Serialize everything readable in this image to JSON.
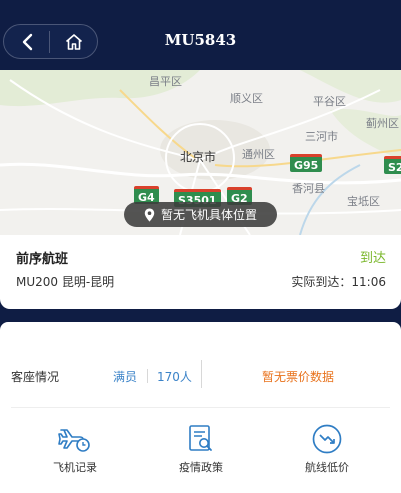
{
  "header": {
    "title": "MU5843"
  },
  "map": {
    "labels": {
      "changping": "昌平区",
      "shunyi": "顺义区",
      "pinggu": "平谷区",
      "jizhou": "蓟州区",
      "sanhe": "三河市",
      "beijing": "北京市",
      "tongzhou": "通州区",
      "xianghe": "香河县",
      "baodi": "宝坻区"
    },
    "shields": {
      "g95": "G95",
      "g4": "G4",
      "s3501": "S3501",
      "g2": "G2",
      "s2": "S2"
    },
    "location_tip": "暂无飞机具体位置"
  },
  "previous_flight": {
    "title": "前序航班",
    "status": "到达",
    "route": "MU200 昆明-昆明",
    "arrival": "实际到达：11:06"
  },
  "seats": {
    "label": "客座情况",
    "status": "满员",
    "count": "170人",
    "price_info": "暂无票价数据"
  },
  "actions": {
    "flight_records": "飞机记录",
    "epidemic_policy": "疫情政策",
    "low_price": "航线低价"
  },
  "colors": {
    "navy": "#0f1d44",
    "arrived_green": "#7ab72b",
    "link_blue": "#3b83c8",
    "warning_orange": "#e8721c"
  }
}
